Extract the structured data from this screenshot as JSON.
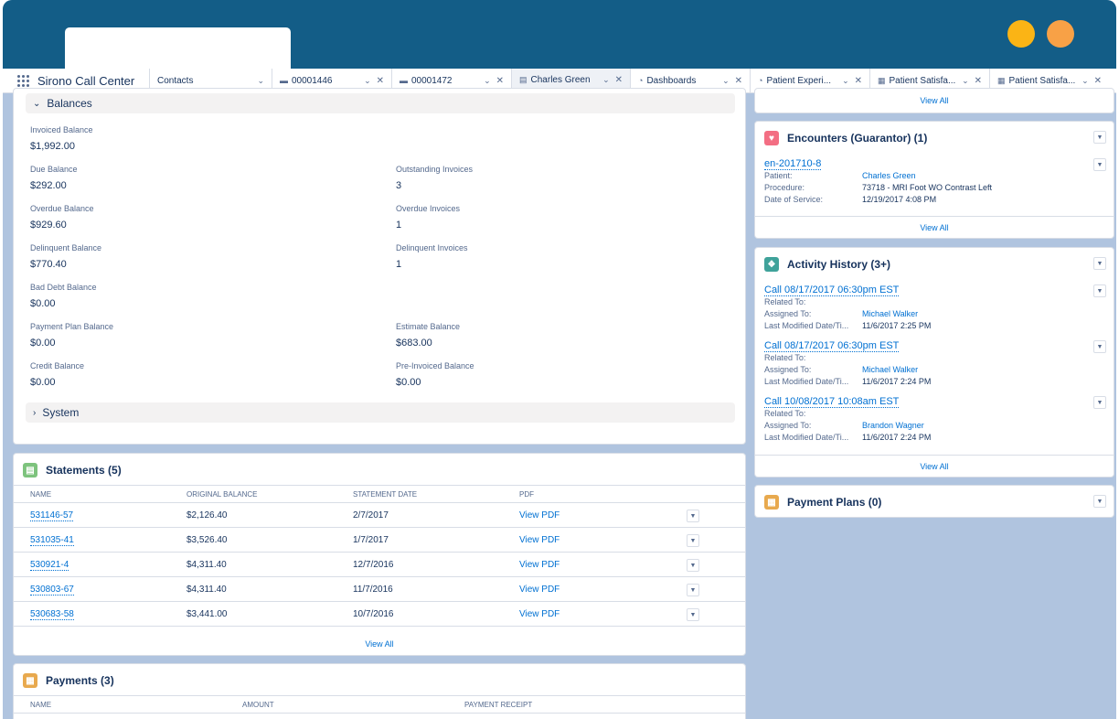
{
  "nav": {
    "app_name": "Sirono Call Center",
    "tabs": [
      {
        "label": "Contacts",
        "icon": "",
        "active": false,
        "closable": false
      },
      {
        "label": "00001446",
        "icon": "case-icon",
        "active": false,
        "closable": true
      },
      {
        "label": "00001472",
        "icon": "case-icon",
        "active": false,
        "closable": true
      },
      {
        "label": "Charles Green",
        "icon": "contact-card-icon",
        "active": true,
        "closable": true
      },
      {
        "label": "Dashboards",
        "icon": "dashboard-icon",
        "active": false,
        "closable": true
      },
      {
        "label": "Patient Experi...",
        "icon": "dashboard-icon",
        "active": false,
        "closable": true
      },
      {
        "label": "Patient Satisfa...",
        "icon": "report-icon",
        "active": false,
        "closable": true
      },
      {
        "label": "Patient Satisfa...",
        "icon": "report-icon",
        "active": false,
        "closable": true
      }
    ]
  },
  "balances": {
    "section_label": "Balances",
    "left_fields": [
      {
        "label": "Invoiced Balance",
        "value": "$1,992.00"
      },
      {
        "label": "Due Balance",
        "value": "$292.00"
      },
      {
        "label": "Overdue Balance",
        "value": "$929.60"
      },
      {
        "label": "Delinquent Balance",
        "value": "$770.40"
      },
      {
        "label": "Bad Debt Balance",
        "value": "$0.00"
      },
      {
        "label": "Payment Plan Balance",
        "value": "$0.00"
      },
      {
        "label": "Credit Balance",
        "value": "$0.00"
      }
    ],
    "right_fields": [
      {
        "label": "Outstanding Invoices",
        "value": "3"
      },
      {
        "label": "Overdue Invoices",
        "value": "1"
      },
      {
        "label": "Delinquent Invoices",
        "value": "1"
      },
      {
        "label": "Estimate Balance",
        "value": "$683.00"
      },
      {
        "label": "Pre-Invoiced Balance",
        "value": "$0.00"
      }
    ],
    "system_label": "System"
  },
  "statements": {
    "title": "Statements (5)",
    "columns": [
      "NAME",
      "ORIGINAL BALANCE",
      "STATEMENT DATE",
      "PDF"
    ],
    "rows": [
      {
        "name": "531146-57",
        "balance": "$2,126.40",
        "date": "2/7/2017",
        "pdf": "View PDF"
      },
      {
        "name": "531035-41",
        "balance": "$3,526.40",
        "date": "1/7/2017",
        "pdf": "View PDF"
      },
      {
        "name": "530921-4",
        "balance": "$4,311.40",
        "date": "12/7/2016",
        "pdf": "View PDF"
      },
      {
        "name": "530803-67",
        "balance": "$4,311.40",
        "date": "11/7/2016",
        "pdf": "View PDF"
      },
      {
        "name": "530683-58",
        "balance": "$3,441.00",
        "date": "10/7/2016",
        "pdf": "View PDF"
      }
    ],
    "view_all": "View All"
  },
  "payments": {
    "title": "Payments (3)",
    "columns": [
      "NAME",
      "AMOUNT",
      "PAYMENT RECEIPT"
    ]
  },
  "top_card": {
    "view_all": "View All"
  },
  "encounters": {
    "title": "Encounters (Guarantor) (1)",
    "record": {
      "title": "en-201710-8",
      "lines": [
        {
          "key": "Patient:",
          "value": "Charles Green",
          "link": true
        },
        {
          "key": "Procedure:",
          "value": "73718 - MRI Foot WO Contrast Left",
          "link": false
        },
        {
          "key": "Date of Service:",
          "value": "12/19/2017 4:08 PM",
          "link": false
        }
      ]
    },
    "view_all": "View All"
  },
  "activity": {
    "title": "Activity History (3+)",
    "records": [
      {
        "title": "Call 08/17/2017 06:30pm EST",
        "related": "Related To:",
        "assigned_key": "Assigned To:",
        "assigned": "Michael Walker",
        "modified_key": "Last Modified Date/Ti...",
        "modified": "11/6/2017 2:25 PM"
      },
      {
        "title": "Call 08/17/2017 06:30pm EST",
        "related": "Related To:",
        "assigned_key": "Assigned To:",
        "assigned": "Michael Walker",
        "modified_key": "Last Modified Date/Ti...",
        "modified": "11/6/2017 2:24 PM"
      },
      {
        "title": "Call 10/08/2017 10:08am EST",
        "related": "Related To:",
        "assigned_key": "Assigned To:",
        "assigned": "Brandon Wagner",
        "modified_key": "Last Modified Date/Ti...",
        "modified": "11/6/2017 2:24 PM"
      }
    ],
    "view_all": "View All"
  },
  "payment_plans": {
    "title": "Payment Plans (0)"
  },
  "colors": {
    "header": "#135d87",
    "link": "#0070d2",
    "background": "#b0c4df",
    "dot_yellow": "#fbb415",
    "dot_orange": "#f8a146"
  }
}
